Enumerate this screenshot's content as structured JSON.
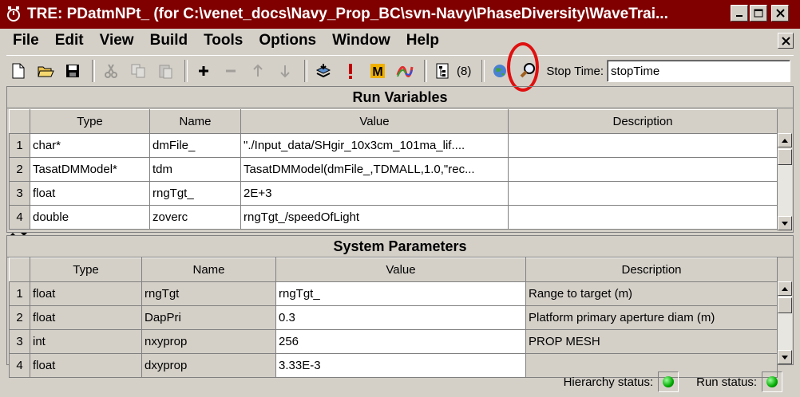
{
  "window": {
    "title": "TRE:  PDatmNPt_ (for C:\\venet_docs\\Navy_Prop_BC\\svn-Navy\\PhaseDiversity\\WaveTrai..."
  },
  "menu": [
    {
      "label": "File"
    },
    {
      "label": "Edit"
    },
    {
      "label": "View"
    },
    {
      "label": "Build"
    },
    {
      "label": "Tools"
    },
    {
      "label": "Options"
    },
    {
      "label": "Window"
    },
    {
      "label": "Help"
    }
  ],
  "toolbar": {
    "count_label": "(8)",
    "stop_time_label": "Stop Time:",
    "stop_time_value": "stopTime"
  },
  "run_variables": {
    "title": "Run Variables",
    "columns": [
      "Type",
      "Name",
      "Value",
      "Description"
    ],
    "rows": [
      {
        "n": "1",
        "type": "char*",
        "name": "dmFile_",
        "value": "\"./Input_data/SHgir_10x3cm_101ma_lif....",
        "desc": ""
      },
      {
        "n": "2",
        "type": "TasatDMModel*",
        "name": "tdm",
        "value": "TasatDMModel(dmFile_,TDMALL,1.0,\"rec...",
        "desc": ""
      },
      {
        "n": "3",
        "type": "float",
        "name": "rngTgt_",
        "value": "2E+3",
        "desc": ""
      },
      {
        "n": "4",
        "type": "double",
        "name": "zoverc",
        "value": "rngTgt_/speedOfLight",
        "desc": ""
      }
    ]
  },
  "system_parameters": {
    "title": "System Parameters",
    "columns": [
      "Type",
      "Name",
      "Value",
      "Description"
    ],
    "rows": [
      {
        "n": "1",
        "type": "float",
        "name": "rngTgt",
        "value": "rngTgt_",
        "desc": "Range to target (m)"
      },
      {
        "n": "2",
        "type": "float",
        "name": "DapPri",
        "value": "0.3",
        "desc": "Platform primary aperture diam (m)"
      },
      {
        "n": "3",
        "type": "int",
        "name": "nxyprop",
        "value": "256",
        "desc": "PROP MESH"
      },
      {
        "n": "4",
        "type": "float",
        "name": "dxyprop",
        "value": "3.33E-3",
        "desc": ""
      }
    ]
  },
  "status": {
    "hierarchy_label": "Hierarchy status:",
    "run_label": "Run status:"
  }
}
